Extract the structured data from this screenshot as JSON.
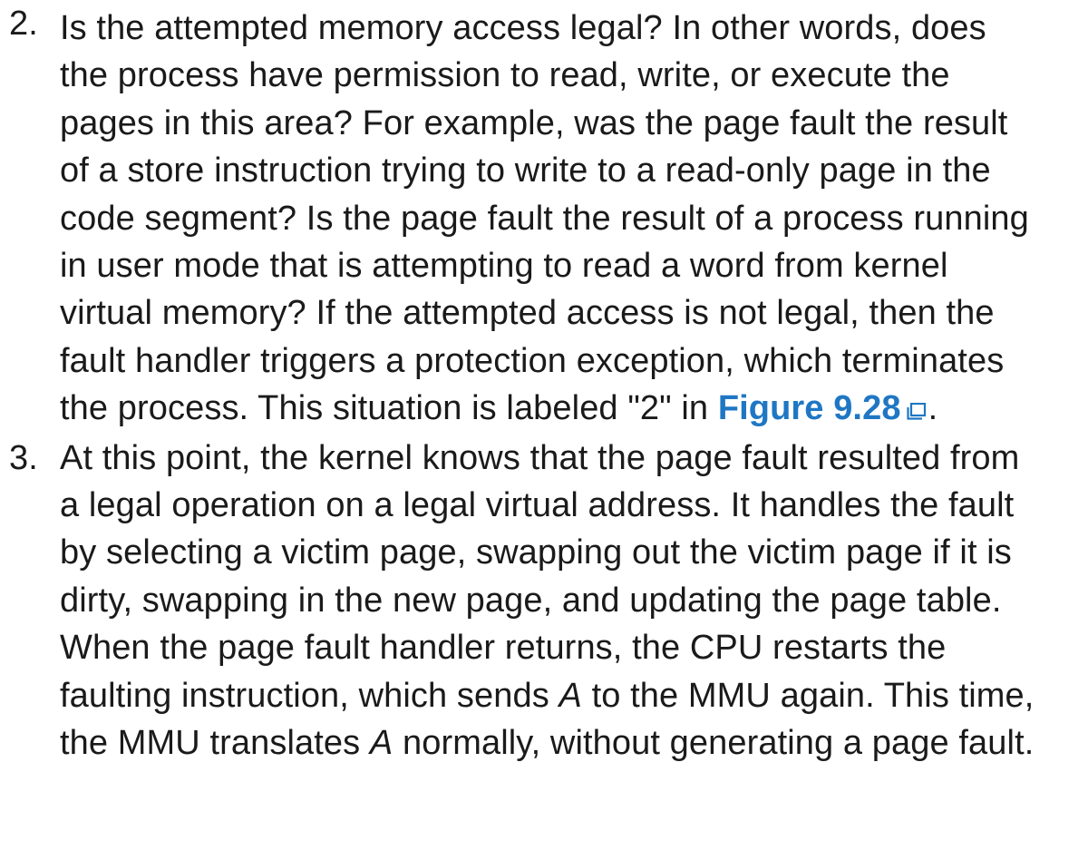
{
  "list": {
    "item2": {
      "number": "2.",
      "lines": [
        "Is the attempted memory access legal? In other words, does",
        "the process have permission to read, write, or execute the",
        "pages in this area? For example, was the page fault the result",
        "of a store instruction trying to write to a read-only page in the",
        "code segment? Is the page fault the result of a process running",
        "in user mode that is attempting to read a word from kernel",
        "virtual memory? If the attempted access is not legal, then the",
        "fault handler triggers a protection exception, which terminates"
      ],
      "last_line_prefix": "the process. This situation is labeled \"2\" in ",
      "link_text": "Figure 9.28",
      "link_icon": "external-link-icon",
      "last_line_suffix": "."
    },
    "item3": {
      "number": "3.",
      "lines": [
        "At this point, the kernel knows that the page fault resulted from",
        "a legal operation on a legal virtual address. It handles the fault",
        "by selecting a victim page, swapping out the victim page if it is",
        "dirty, swapping in the new page, and updating the page table.",
        "When the page fault handler returns, the CPU restarts the"
      ],
      "line6_a": "faulting instruction, which sends ",
      "line6_var": "A",
      "line6_b": " to the MMU again. This time,",
      "line7_a": "the MMU translates ",
      "line7_var": "A",
      "line7_b": " normally, without generating a page fault."
    }
  },
  "colors": {
    "text": "#1a1a1a",
    "link": "#1f77c4"
  }
}
